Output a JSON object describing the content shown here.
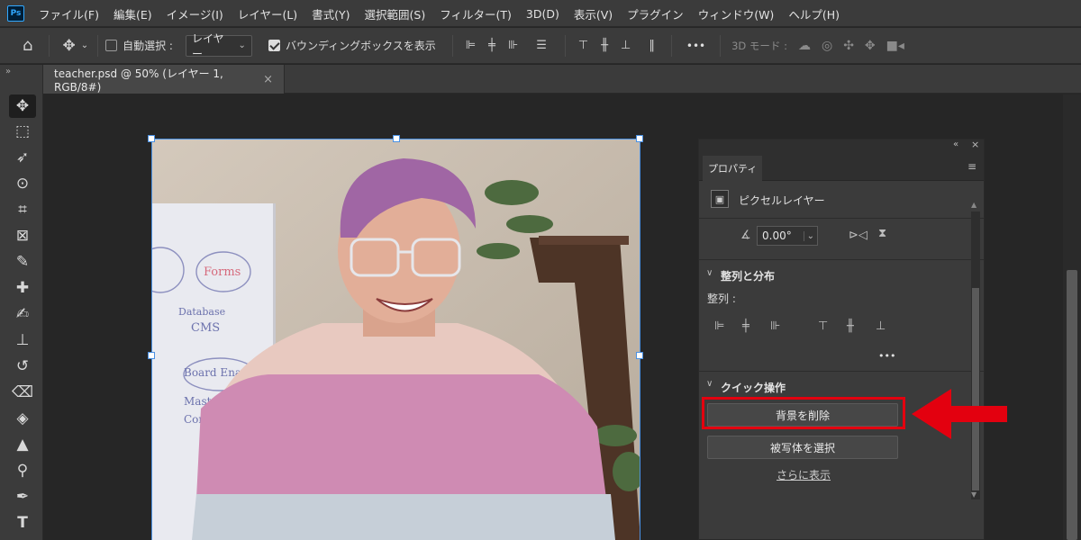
{
  "app": {
    "logo": "Ps"
  },
  "menu": [
    "ファイル(F)",
    "編集(E)",
    "イメージ(I)",
    "レイヤー(L)",
    "書式(Y)",
    "選択範囲(S)",
    "フィルター(T)",
    "3D(D)",
    "表示(V)",
    "プラグイン",
    "ウィンドウ(W)",
    "ヘルプ(H)"
  ],
  "options": {
    "auto_select_label": "自動選択 :",
    "auto_select_value": "レイヤー",
    "bounding_box_label": "バウンディングボックスを表示",
    "more": "•••",
    "mode_3d_label": "3D モード :"
  },
  "document": {
    "tab_title": "teacher.psd @ 50% (レイヤー 1, RGB/8#)",
    "close": "×"
  },
  "whiteboard": {
    "forms": "Forms",
    "database": "Database",
    "cms": "CMS",
    "board": "Board Ena",
    "mast": "Mast",
    "con": "Con"
  },
  "properties": {
    "tab": "プロパティ",
    "layer_type": "ピクセルレイヤー",
    "angle_value": "0.00°",
    "align_section": "整列と分布",
    "align_label": "整列 :",
    "more": "•••",
    "quick_actions": "クイック操作",
    "remove_bg_button": "背景を削除",
    "select_subject_button": "被写体を選択",
    "show_more_link": "さらに表示"
  },
  "icons": [
    "move-icon",
    "marquee-icon",
    "lasso-icon",
    "quick-select-icon",
    "crop-icon",
    "frame-icon",
    "eyedropper-icon",
    "healing-icon",
    "brush-icon",
    "stamp-icon",
    "history-brush-icon",
    "eraser-icon",
    "paint-bucket-icon",
    "shape-triangle-icon",
    "zoom-icon",
    "pen-icon",
    "type-icon"
  ],
  "colors": {
    "highlight": "#e3000f",
    "selection": "#4a90e2",
    "ps_blue": "#31a8ff"
  }
}
